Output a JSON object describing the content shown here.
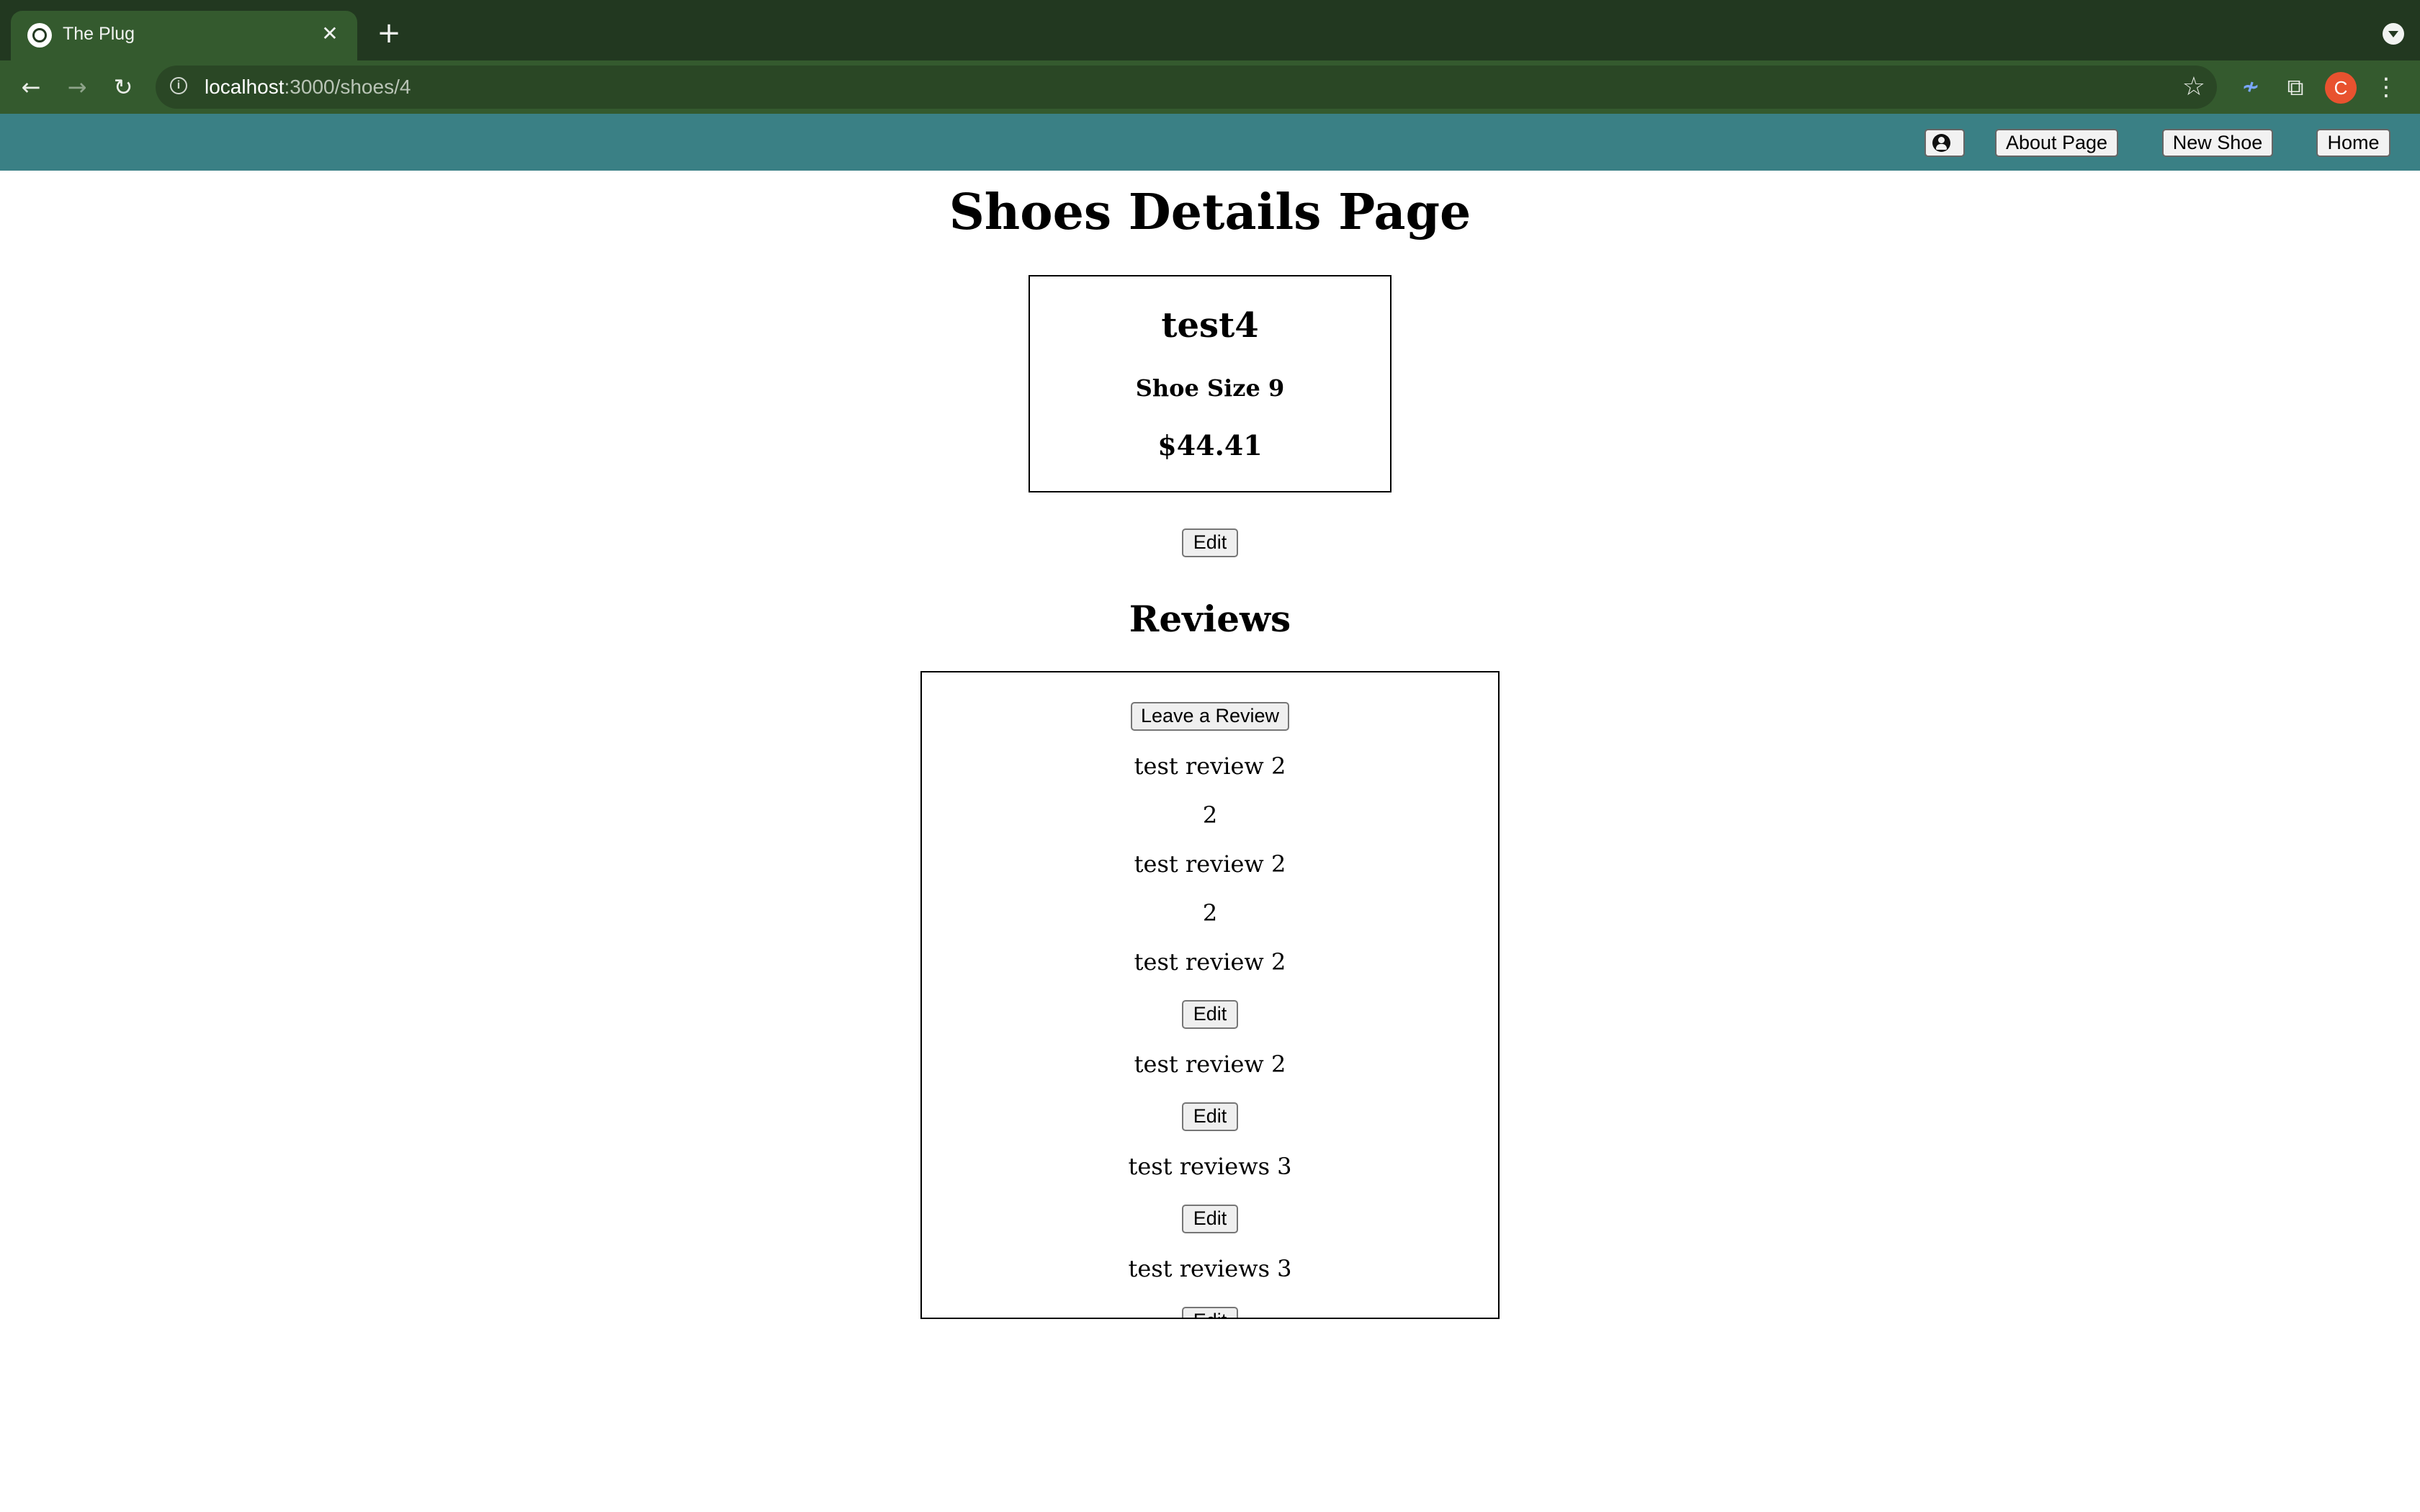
{
  "browser": {
    "tab_title": "The Plug",
    "url_host": "localhost",
    "url_path": ":3000/shoes/4",
    "avatar_letter": "C"
  },
  "navbar": {
    "buttons": [
      {
        "label": "About Page"
      },
      {
        "label": "New Shoe"
      },
      {
        "label": "Home"
      }
    ]
  },
  "page": {
    "title": "Shoes Details Page"
  },
  "shoe": {
    "name": "test4",
    "size": "Shoe Size 9",
    "price": "$44.41",
    "edit_label": "Edit"
  },
  "reviews": {
    "heading": "Reviews",
    "leave_review_label": "Leave a Review",
    "lines": [
      "test review 2",
      "2",
      "test review 2",
      "2",
      "test review 2"
    ],
    "edit_label": "Edit",
    "entries": [
      "test review 2",
      "test reviews 3",
      "test reviews 3"
    ]
  },
  "colors": {
    "tabstrip": "#223820",
    "toolbar": "#345a2e",
    "navbar": "#3a8085",
    "avatar": "#e8522f"
  }
}
